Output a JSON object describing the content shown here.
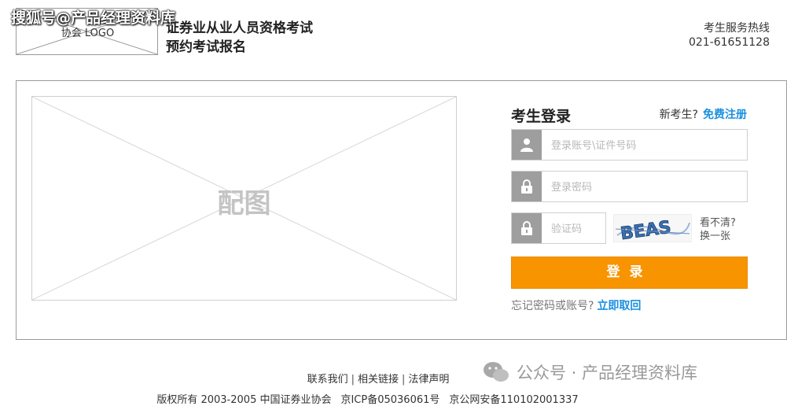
{
  "watermark": {
    "top": "搜狐号@产品经理资料库",
    "bottom": "公众号 · 产品经理资料库"
  },
  "header": {
    "logo_text": "协会 LOGO",
    "title_line1": "证券业从业人员资格考试",
    "title_line2": "预约考试报名",
    "hotline_label": "考生服务热线",
    "hotline_number": "021-61651128"
  },
  "banner": {
    "placeholder_label": "配图"
  },
  "login": {
    "title": "考生登录",
    "new_user_prompt": "新考生?",
    "register_link": "免费注册",
    "account_placeholder": "登录账号\\证件号码",
    "password_placeholder": "登录密码",
    "captcha_placeholder": "验证码",
    "captcha_text": "BEAS",
    "refresh_line1": "看不清?",
    "refresh_line2": "换一张",
    "submit_label": "登录",
    "forgot_prompt": "忘记密码或账号?",
    "forgot_link": "立即取回"
  },
  "footer": {
    "links": [
      "联系我们",
      "相关链接",
      "法律声明"
    ],
    "copyright": "版权所有 2003-2005 中国证券业协会",
    "icp": "京ICP备05036061号",
    "police": "京公网安备110102001337"
  },
  "colors": {
    "accent_orange": "#f79400",
    "link_blue": "#1a8fe0",
    "icon_gray": "#9e9e9e"
  }
}
